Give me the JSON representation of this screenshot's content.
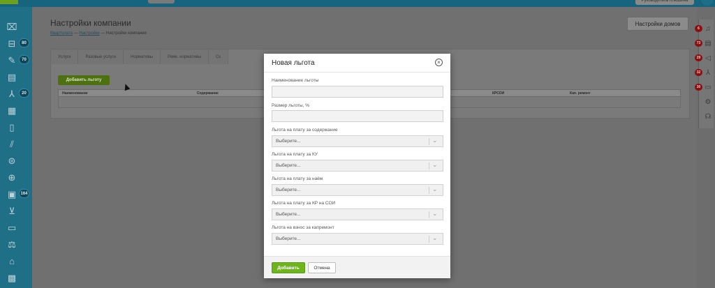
{
  "topbar": {
    "user_label": "Руководитель Клюшина"
  },
  "sidebar": {
    "items": [
      {
        "icon": "folder-icon",
        "glyph": "⌧"
      },
      {
        "icon": "inbox-icon",
        "glyph": "⊟",
        "badge": "80"
      },
      {
        "icon": "edit-icon",
        "glyph": "✎",
        "badge": "70"
      },
      {
        "icon": "document-icon",
        "glyph": "▤"
      },
      {
        "icon": "hierarchy-icon",
        "glyph": "⅄",
        "badge": "20"
      },
      {
        "icon": "building-icon",
        "glyph": "▦"
      },
      {
        "icon": "list-icon",
        "glyph": "▯"
      },
      {
        "icon": "chart-icon",
        "glyph": "⫽"
      },
      {
        "icon": "support-icon",
        "glyph": "⊜"
      },
      {
        "icon": "user-icon",
        "glyph": "⊕"
      },
      {
        "icon": "clipboard-icon",
        "glyph": "▣",
        "badge": "164"
      },
      {
        "icon": "cart-icon",
        "glyph": "⊻"
      },
      {
        "icon": "wallet-icon",
        "glyph": "▭"
      },
      {
        "icon": "scales-icon",
        "glyph": "⚖"
      },
      {
        "icon": "car-icon",
        "glyph": "⌂"
      },
      {
        "icon": "calculator-icon",
        "glyph": "▩"
      }
    ]
  },
  "page": {
    "title": "Настройки компании",
    "breadcrumbs": [
      {
        "label": "Квартплата",
        "link": true
      },
      {
        "label": " — ",
        "link": false
      },
      {
        "label": "Настройки",
        "link": true
      },
      {
        "label": " — Настройки компании",
        "link": false
      }
    ],
    "houses_button": "Настройки домов",
    "tabs": [
      "Услуги",
      "Разовые услуги",
      "Нормативы",
      "Ремк. нормативы",
      "Ск"
    ],
    "add_benefit_button": "Добавить льготу",
    "table_headers": [
      {
        "label": "Наименование"
      },
      {
        "label": "Содержание"
      },
      {
        "label": "КРСОИ"
      },
      {
        "label": "Кап. ремонт"
      }
    ]
  },
  "rightbar": {
    "items": [
      {
        "icon": "bell-icon",
        "glyph": "♫",
        "badge": "6"
      },
      {
        "icon": "archive-icon",
        "glyph": "▤",
        "badge": "73"
      },
      {
        "icon": "megaphone-icon",
        "glyph": "◁",
        "badge": "29"
      },
      {
        "icon": "hierarchy-icon",
        "glyph": "⅄",
        "badge": "32"
      },
      {
        "icon": "chat-icon",
        "glyph": "▭",
        "badge": "30"
      },
      {
        "icon": "gear-icon",
        "glyph": "⚙"
      },
      {
        "icon": "support-chat-icon",
        "glyph": "☊"
      }
    ]
  },
  "modal": {
    "title": "Новая льгота",
    "close_glyph": "×",
    "fields": {
      "name_label": "Наименование льготы",
      "name_value": "",
      "size_label": "Размер льготы, %",
      "size_value": ""
    },
    "selects": [
      {
        "label": "Льгота на плату за содержание",
        "value": "Выберите..."
      },
      {
        "label": "Льгота на плату за КУ",
        "value": "Выберите..."
      },
      {
        "label": "Льгота на плату за наём",
        "value": "Выберите..."
      },
      {
        "label": "Льгота на плату за КР на СОИ",
        "value": "Выберите..."
      },
      {
        "label": "Льгота на взнос за капремонт",
        "value": "Выберите..."
      }
    ],
    "submit_button": "Добавить",
    "cancel_button": "Отмена"
  }
}
